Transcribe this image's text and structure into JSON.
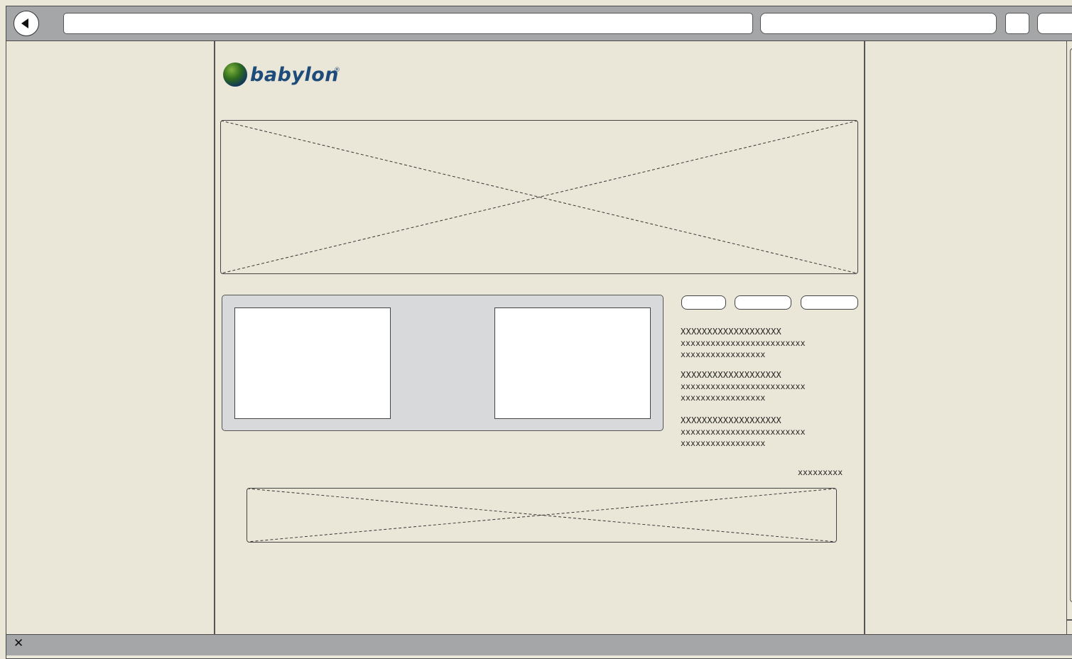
{
  "browser": {
    "back_icon": "back-arrow-icon",
    "close_icon_glyph": "✕"
  },
  "header": {
    "logo_text": "babylon",
    "logo_mark": "®"
  },
  "tabs": [
    "",
    "",
    ""
  ],
  "items": [
    {
      "title": "XXXXXXXXXXXXXXXXXXX",
      "line1": "xxxxxxxxxxxxxxxxxxxxxxxxx",
      "line2": "xxxxxxxxxxxxxxxxx"
    },
    {
      "title": "XXXXXXXXXXXXXXXXXXX",
      "line1": "xxxxxxxxxxxxxxxxxxxxxxxxx",
      "line2": "xxxxxxxxxxxxxxxxx"
    },
    {
      "title": "XXXXXXXXXXXXXXXXXXX",
      "line1": "xxxxxxxxxxxxxxxxxxxxxxxxx",
      "line2": "xxxxxxxxxxxxxxxxx"
    }
  ],
  "more_link": "xxxxxxxxx"
}
